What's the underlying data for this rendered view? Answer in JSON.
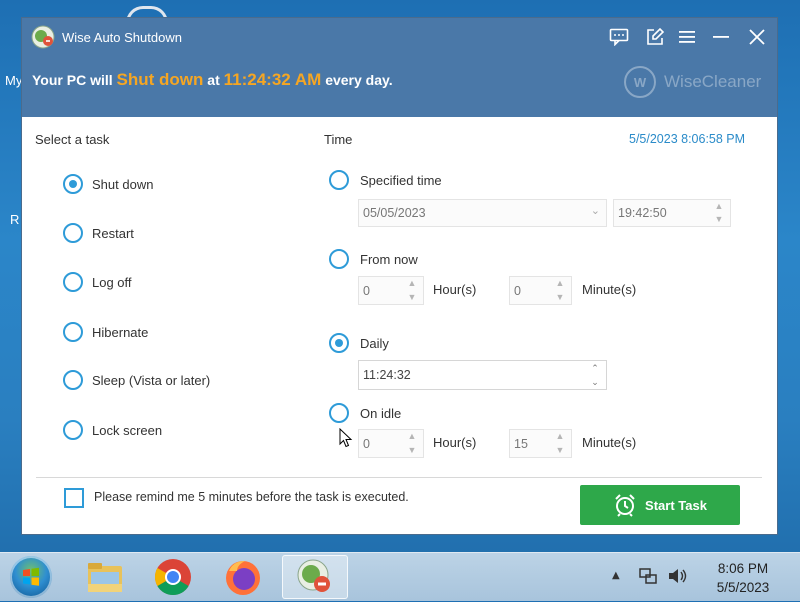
{
  "desktop": {
    "label_1": "My",
    "label_2": "R"
  },
  "window": {
    "title": "Wise Auto Shutdown",
    "banner": {
      "prefix": "Your PC will",
      "action": "Shut down",
      "at": "at",
      "time": "11:24:32 AM",
      "suffix": "every day."
    },
    "brand": {
      "logo_letter": "W",
      "name": "WiseCleaner"
    },
    "title_buttons": [
      "feedback-icon",
      "edit-icon",
      "menu-icon",
      "minimize-icon",
      "close-icon"
    ]
  },
  "tasks": {
    "heading": "Select a task",
    "selected": "Shut down",
    "items": [
      "Shut down",
      "Restart",
      "Log off",
      "Hibernate",
      "Sleep (Vista or later)",
      "Lock screen"
    ]
  },
  "time": {
    "heading": "Time",
    "now": "5/5/2023 8:06:58 PM",
    "selected": "Daily",
    "specified": {
      "label": "Specified time",
      "date": "05/05/2023",
      "time": "19:42:50"
    },
    "from_now": {
      "label": "From now",
      "hours": "0",
      "hours_unit": "Hour(s)",
      "minutes": "0",
      "minutes_unit": "Minute(s)"
    },
    "daily": {
      "label": "Daily",
      "time": "11:24:32"
    },
    "on_idle": {
      "label": "On idle",
      "hours": "0",
      "hours_unit": "Hour(s)",
      "minutes": "15",
      "minutes_unit": "Minute(s)"
    }
  },
  "footer": {
    "remind_label": "Please remind me 5 minutes before the task is executed.",
    "remind_checked": false,
    "start_button": "Start Task"
  },
  "taskbar": {
    "apps": [
      "file-explorer",
      "chrome",
      "firefox",
      "wise-auto-shutdown"
    ],
    "clock_time": "8:06 PM",
    "clock_date": "5/5/2023"
  },
  "colors": {
    "titlebar": "#4a78a8",
    "accent": "#2e9bd8",
    "highlight": "#f5a623",
    "start": "#2ea84a"
  }
}
